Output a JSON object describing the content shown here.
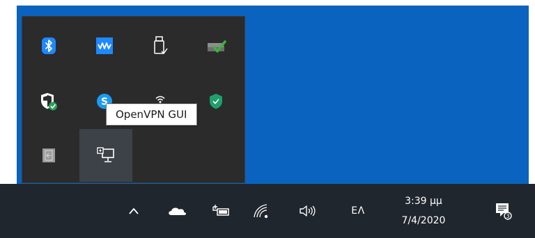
{
  "tooltip": {
    "text": "OpenVPN GUI"
  },
  "tray_flyout": {
    "icons": [
      {
        "name": "bluetooth-icon",
        "color": "#1e88ff"
      },
      {
        "name": "waves-monitor-icon",
        "color": "#1e88ff"
      },
      {
        "name": "usb-drive-icon",
        "color": "#ffffff"
      },
      {
        "name": "drive-check-icon",
        "color": "#3cb33c"
      },
      {
        "name": "windows-security-shield-icon",
        "color": "#ffffff"
      },
      {
        "name": "skype-icon",
        "color": "#1c9bf0"
      },
      {
        "name": "wireless-signal-icon",
        "color": "#ffffff"
      },
      {
        "name": "green-shield-icon",
        "color": "#1f9e6e"
      },
      {
        "name": "safely-remove-icon",
        "color": "#9b9b9b"
      },
      {
        "name": "openvpn-network-icon",
        "color": "#ffffff"
      }
    ]
  },
  "taskbar": {
    "show_hidden_icons": "chevron-up-icon",
    "onedrive": "cloud-icon",
    "power": "battery-plug-icon",
    "network": "wifi-icon",
    "volume": "speaker-icon",
    "language": "ΕΛ",
    "clock": {
      "time": "3:39 μμ",
      "date": "7/4/2020"
    },
    "notifications": "action-center-icon"
  },
  "colors": {
    "desktop": "#0a63bf",
    "taskbar": "#20262d",
    "flyout": "#2b2b2b",
    "hover": "#3d4248"
  }
}
